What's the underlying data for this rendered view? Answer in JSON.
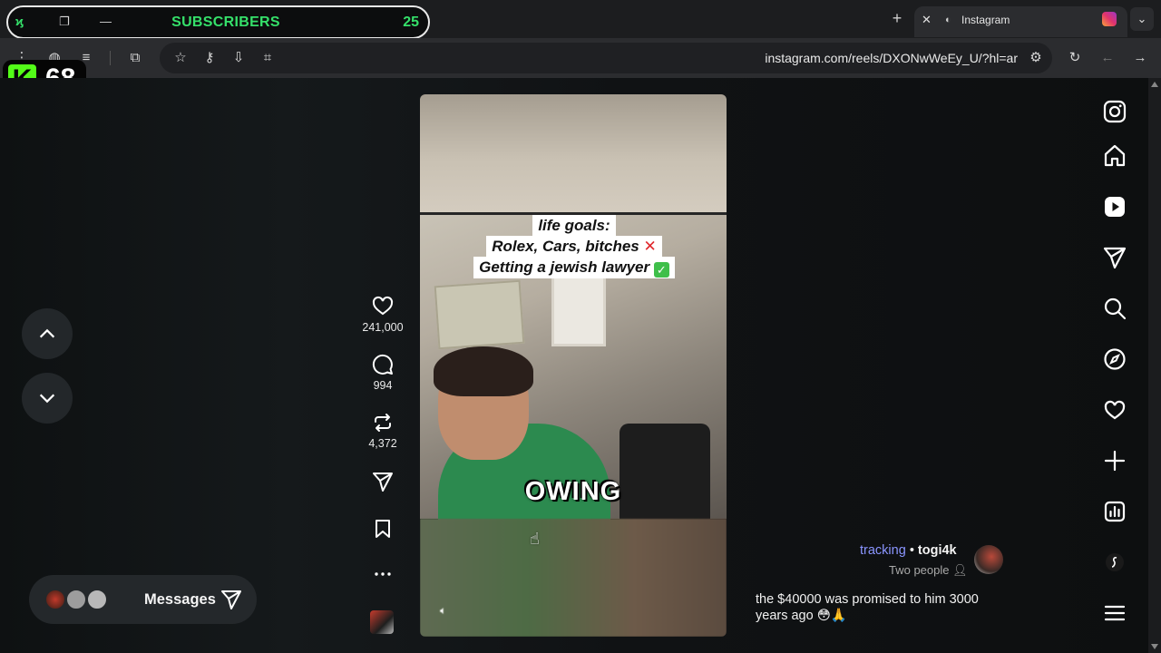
{
  "stream_overlay": {
    "subscribers_label": "SUBSCRIBERS",
    "subscribers_count": "25",
    "kick_letter": "K",
    "kick_count": "68",
    "accent_color": "#35e06a",
    "kick_color": "#53fc18"
  },
  "browser": {
    "tab_title": "Instagram",
    "url": "instagram.com/reels/DXONwWeEy_U/?hl=ar"
  },
  "reel": {
    "caption_lines": [
      "life goals:",
      "Rolex, Cars, bitches",
      "Getting a jewish lawyer"
    ],
    "caption_marks": [
      "✕",
      "✓"
    ],
    "overlay_word": "OWING",
    "likes": "241,000",
    "comments": "994",
    "reposts": "4,372"
  },
  "comment": {
    "tracking_label": "tracking",
    "separator": "•",
    "username": "togi4k",
    "subtitle": "Two people",
    "text": "the $40000 was promised to him 3000 years ago"
  },
  "messages": {
    "label": "Messages"
  },
  "icons": {
    "nav": [
      "instagram-icon",
      "home-icon",
      "reels-icon",
      "direct-icon",
      "search-icon",
      "explore-icon",
      "notifications-icon",
      "create-icon",
      "dashboard-icon",
      "threads-icon",
      "menu-icon"
    ]
  }
}
